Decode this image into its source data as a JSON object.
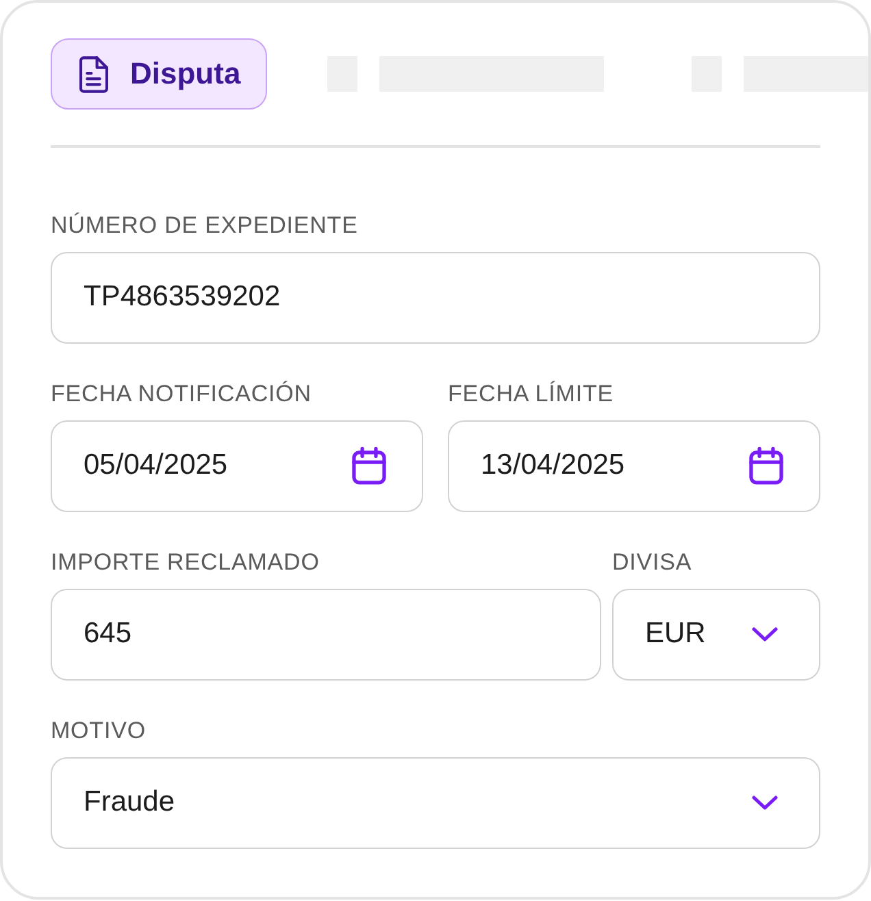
{
  "tabs": [
    {
      "kind": "tab",
      "label": "Disputa",
      "selected": true
    },
    {
      "kind": "skeleton",
      "selected": false
    },
    {
      "kind": "skeleton",
      "selected": false
    }
  ],
  "form": {
    "rows": [
      [
        {
          "kind": "text",
          "label": "NÚMERO DE EXPEDIENTE",
          "value": "TP4863539202"
        }
      ],
      [
        {
          "kind": "date",
          "label": "FECHA NOTIFICACIÓN",
          "value": "05/04/2025"
        },
        {
          "kind": "date",
          "label": "FECHA LÍMITE",
          "value": "13/04/2025"
        }
      ],
      [
        {
          "kind": "text",
          "label": "IMPORTE RECLAMADO",
          "value": "645"
        },
        {
          "kind": "select",
          "label": "DIVISA",
          "value": "EUR"
        }
      ],
      [
        {
          "kind": "select",
          "label": "MOTIVO",
          "value": "Fraude"
        }
      ]
    ]
  }
}
